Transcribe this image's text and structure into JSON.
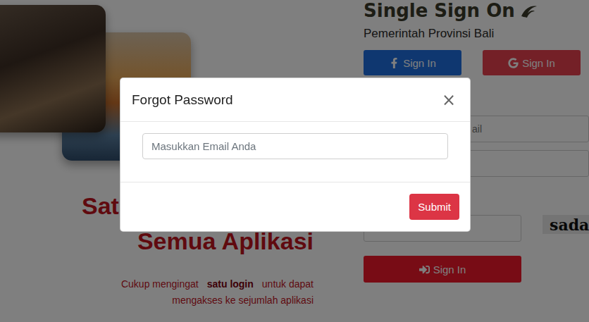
{
  "header": {
    "title": "Single Sign On",
    "subtitle": "Pemerintah Provinsi Bali"
  },
  "social_buttons": [
    {
      "label": "Sign In",
      "kind": "facebook",
      "color": "#1f6fe0"
    },
    {
      "label": "Sign In",
      "kind": "google",
      "color": "#e8404f"
    }
  ],
  "fields": [
    {
      "placeholder": "ail"
    },
    {
      "placeholder": ""
    }
  ],
  "captcha": {
    "placeholder": "",
    "image_text": "sada"
  },
  "sign_in_button": "Sign In",
  "hero": {
    "title_lines": [
      "Sat",
      "Semua Aplikasi"
    ],
    "subtitle_lines": [
      [
        {
          "text": "Cukup mengingat",
          "bold": false
        },
        {
          "text": "satu login",
          "bold": true
        },
        {
          "text": "untuk dapat",
          "bold": false
        }
      ],
      [
        {
          "text": "mengakses ke sejumlah aplikasi",
          "bold": false
        }
      ]
    ]
  },
  "modal": {
    "title": "Forgot Password",
    "close": "×",
    "email_placeholder": "Masukkan Email Anda",
    "submit": "Submit"
  }
}
